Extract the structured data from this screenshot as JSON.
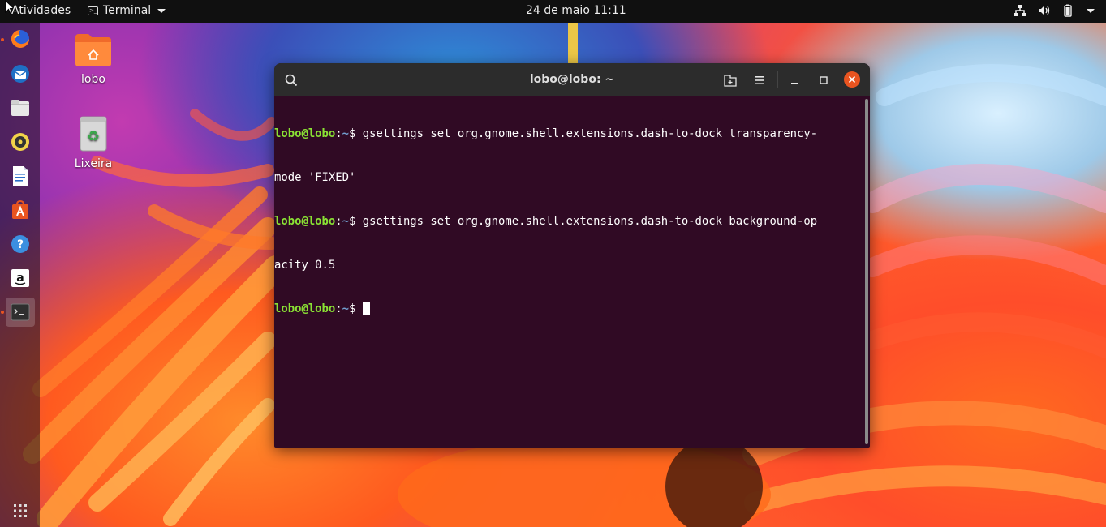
{
  "topbar": {
    "activities": "Atividades",
    "app_menu_label": "Terminal",
    "clock": "24 de maio  11:11",
    "tray_icons": [
      "network-icon",
      "volume-icon",
      "battery-icon",
      "power-menu-caret-icon"
    ]
  },
  "dock": {
    "items": [
      {
        "name": "firefox",
        "icon": "firefox-icon",
        "running": true
      },
      {
        "name": "thunderbird",
        "icon": "thunderbird-icon",
        "running": false
      },
      {
        "name": "files",
        "icon": "files-icon",
        "running": false
      },
      {
        "name": "rhythmbox",
        "icon": "rhythmbox-icon",
        "running": false
      },
      {
        "name": "libreoffice-writer",
        "icon": "writer-icon",
        "running": false
      },
      {
        "name": "ubuntu-software",
        "icon": "software-icon",
        "running": false
      },
      {
        "name": "help",
        "icon": "help-icon",
        "running": false
      },
      {
        "name": "amazon",
        "icon": "amazon-icon",
        "running": false
      },
      {
        "name": "terminal",
        "icon": "terminal-icon",
        "running": true
      }
    ],
    "show_apps_icon": "grid-icon"
  },
  "desktop": {
    "home_label": "lobo",
    "trash_label": "Lixeira"
  },
  "window": {
    "title": "lobo@lobo: ~",
    "buttons": [
      "search-icon",
      "new-tab-icon",
      "hamburger-menu-icon",
      "minimize-icon",
      "maximize-icon",
      "close-icon"
    ]
  },
  "terminal": {
    "lines": [
      {
        "user": "lobo@lobo",
        "path": "~",
        "symbol": "$ ",
        "text": "gsettings set org.gnome.shell.extensions.dash-to-dock transparency-"
      },
      {
        "user": "",
        "path": "",
        "symbol": "",
        "text": "mode 'FIXED'"
      },
      {
        "user": "lobo@lobo",
        "path": "~",
        "symbol": "$ ",
        "text": "gsettings set org.gnome.shell.extensions.dash-to-dock background-op"
      },
      {
        "user": "",
        "path": "",
        "symbol": "",
        "text": "acity 0.5"
      },
      {
        "user": "lobo@lobo",
        "path": "~",
        "symbol": "$ ",
        "text": ""
      }
    ],
    "colors": {
      "background": "#300a24",
      "user": "#8ae234",
      "path": "#729fcf",
      "text": "#ffffff"
    }
  },
  "colors": {
    "accent": "#e95420",
    "topbar": "#101010",
    "headerbar": "#2c2c2c"
  }
}
